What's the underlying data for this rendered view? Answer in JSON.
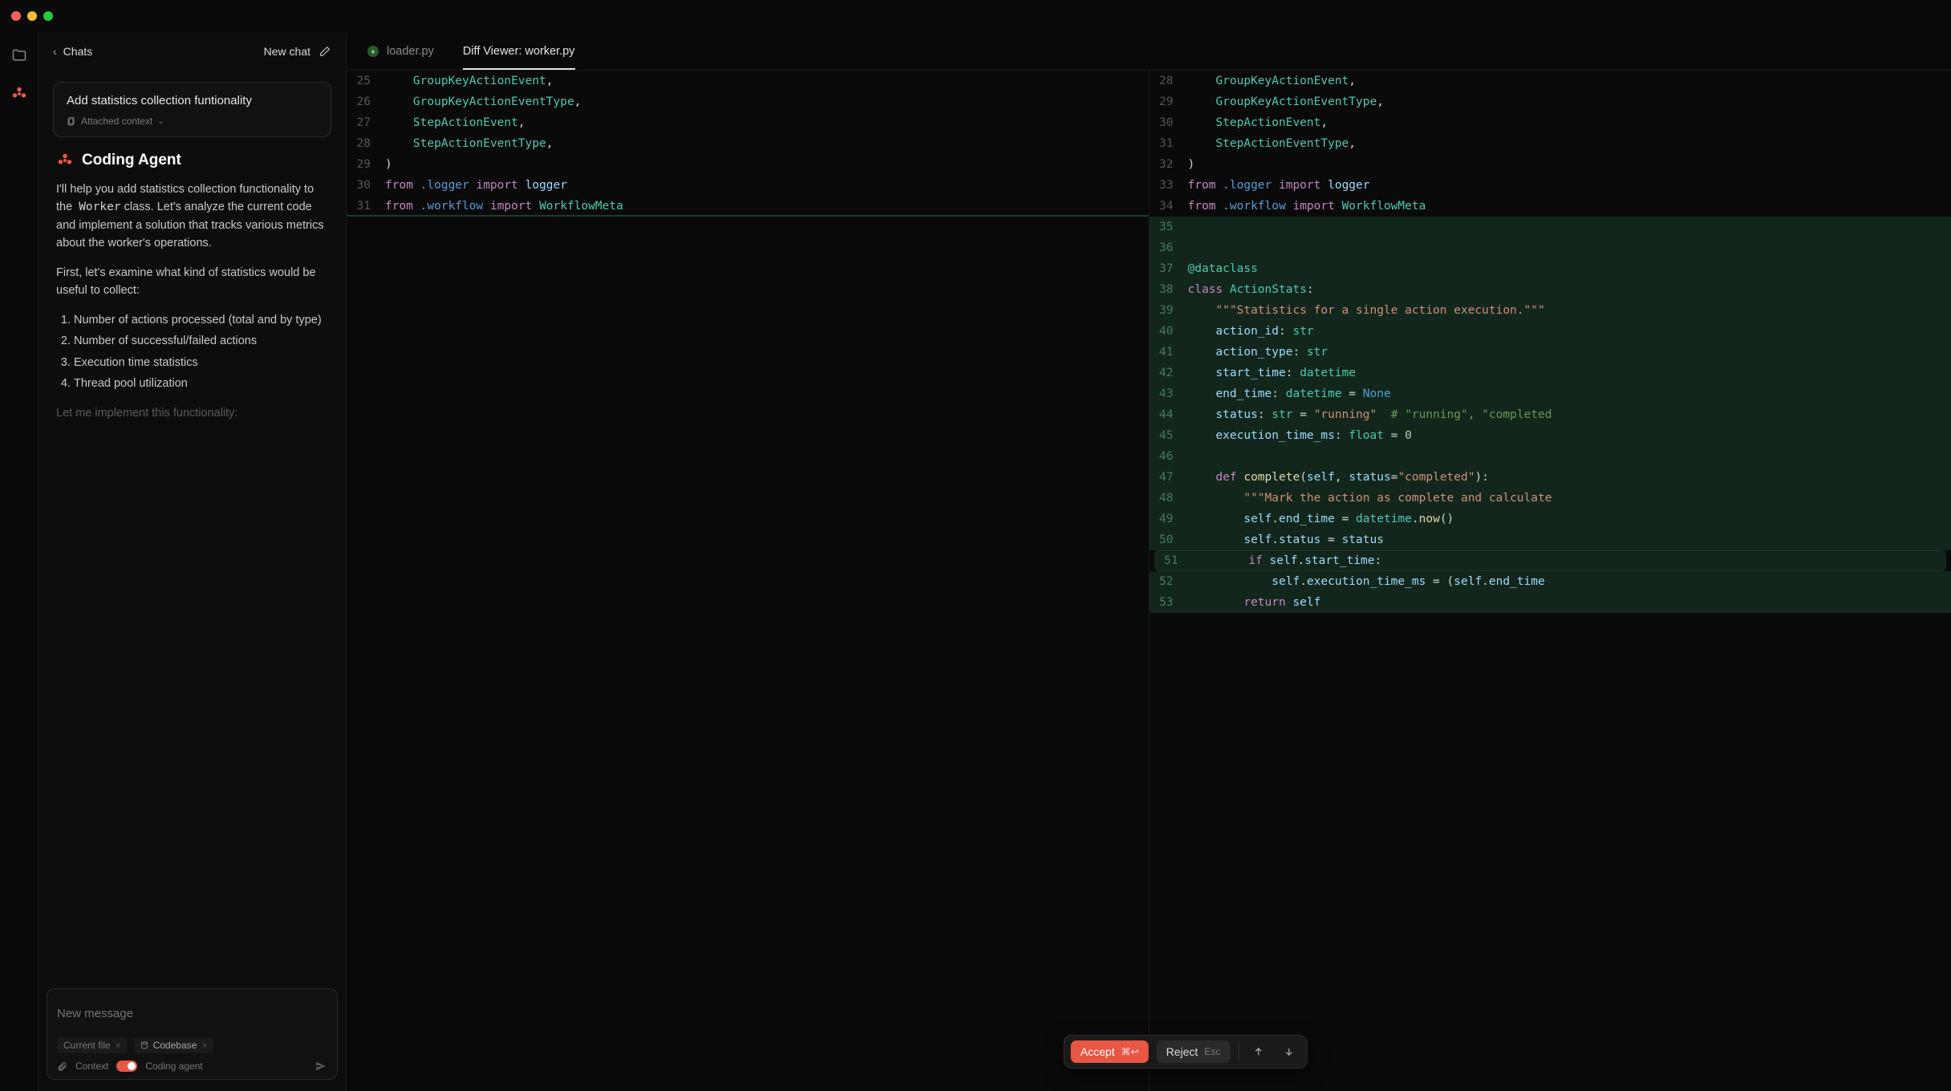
{
  "sidebar": {
    "back_label": "Chats",
    "new_chat_label": "New chat",
    "conversation": {
      "title": "Add statistics collection funtionality",
      "attached_label": "Attached context"
    },
    "agent": {
      "title": "Coding Agent",
      "intro_pre": "I'll help you add statistics collection functionality to the ",
      "intro_code": "Worker",
      "intro_post": " class. Let's analyze the current code and implement a solution that tracks various metrics about the worker's operations.",
      "para2": "First, let's examine what kind of statistics would be useful to collect:",
      "bullets": [
        "Number of actions processed (total and by type)",
        "Number of successful/failed actions",
        "Execution time statistics",
        "Thread pool utilization"
      ],
      "closing": "Let me implement this functionality:"
    },
    "composer": {
      "placeholder": "New message",
      "chip_current": "Current file",
      "chip_codebase": "Codebase",
      "context_label": "Context",
      "mode_label": "Coding agent"
    }
  },
  "tabs": [
    {
      "label": "loader.py",
      "active": false,
      "hasIcon": true
    },
    {
      "label": "Diff Viewer: worker.py",
      "active": true,
      "hasIcon": false
    }
  ],
  "diff": {
    "left": [
      {
        "n": 25,
        "tokens": [
          [
            "    ",
            ""
          ],
          [
            "GroupKeyActionEvent",
            "t-type"
          ],
          [
            ",",
            "t-pl"
          ]
        ]
      },
      {
        "n": 26,
        "tokens": [
          [
            "    ",
            ""
          ],
          [
            "GroupKeyActionEventType",
            "t-type"
          ],
          [
            ",",
            "t-pl"
          ]
        ]
      },
      {
        "n": 27,
        "tokens": [
          [
            "    ",
            ""
          ],
          [
            "StepActionEvent",
            "t-type"
          ],
          [
            ",",
            "t-pl"
          ]
        ]
      },
      {
        "n": 28,
        "tokens": [
          [
            "    ",
            ""
          ],
          [
            "StepActionEventType",
            "t-type"
          ],
          [
            ",",
            "t-pl"
          ]
        ]
      },
      {
        "n": 29,
        "tokens": [
          [
            ")",
            "t-pl"
          ]
        ]
      },
      {
        "n": 30,
        "tokens": [
          [
            "from ",
            "t-kw"
          ],
          [
            ".logger",
            "t-mod"
          ],
          [
            " import ",
            "t-kw"
          ],
          [
            "logger",
            "t-ident"
          ]
        ]
      },
      {
        "n": 31,
        "tokens": [
          [
            "from ",
            "t-kw"
          ],
          [
            ".workflow",
            "t-mod"
          ],
          [
            " import ",
            "t-kw"
          ],
          [
            "WorkflowMeta",
            "t-type"
          ]
        ],
        "edgeGreen": true
      }
    ],
    "right": [
      {
        "n": 28,
        "tokens": [
          [
            "    ",
            ""
          ],
          [
            "GroupKeyActionEvent",
            "t-type"
          ],
          [
            ",",
            "t-pl"
          ]
        ]
      },
      {
        "n": 29,
        "tokens": [
          [
            "    ",
            ""
          ],
          [
            "GroupKeyActionEventType",
            "t-type"
          ],
          [
            ",",
            "t-pl"
          ]
        ]
      },
      {
        "n": 30,
        "tokens": [
          [
            "    ",
            ""
          ],
          [
            "StepActionEvent",
            "t-type"
          ],
          [
            ",",
            "t-pl"
          ]
        ]
      },
      {
        "n": 31,
        "tokens": [
          [
            "    ",
            ""
          ],
          [
            "StepActionEventType",
            "t-type"
          ],
          [
            ",",
            "t-pl"
          ]
        ]
      },
      {
        "n": 32,
        "tokens": [
          [
            ")",
            "t-pl"
          ]
        ]
      },
      {
        "n": 33,
        "tokens": [
          [
            "from ",
            "t-kw"
          ],
          [
            ".logger",
            "t-mod"
          ],
          [
            " import ",
            "t-kw"
          ],
          [
            "logger",
            "t-ident"
          ]
        ]
      },
      {
        "n": 34,
        "tokens": [
          [
            "from ",
            "t-kw"
          ],
          [
            ".workflow",
            "t-mod"
          ],
          [
            " import ",
            "t-kw"
          ],
          [
            "WorkflowMeta",
            "t-type"
          ]
        ]
      },
      {
        "n": 35,
        "green": true,
        "tokens": []
      },
      {
        "n": 36,
        "green": true,
        "tokens": []
      },
      {
        "n": 37,
        "green": true,
        "tokens": [
          [
            "@dataclass",
            "t-dec"
          ]
        ]
      },
      {
        "n": 38,
        "green": true,
        "tokens": [
          [
            "class ",
            "t-kw"
          ],
          [
            "ActionStats",
            "t-type"
          ],
          [
            ":",
            "t-pl"
          ]
        ]
      },
      {
        "n": 39,
        "green": true,
        "tokens": [
          [
            "    ",
            ""
          ],
          [
            "\"\"\"Statistics for a single action execution.\"\"\"",
            "t-str"
          ]
        ]
      },
      {
        "n": 40,
        "green": true,
        "tokens": [
          [
            "    ",
            ""
          ],
          [
            "action_id",
            "t-ident"
          ],
          [
            ": ",
            "t-pl"
          ],
          [
            "str",
            "t-type"
          ]
        ]
      },
      {
        "n": 41,
        "green": true,
        "tokens": [
          [
            "    ",
            ""
          ],
          [
            "action_type",
            "t-ident"
          ],
          [
            ": ",
            "t-pl"
          ],
          [
            "str",
            "t-type"
          ]
        ]
      },
      {
        "n": 42,
        "green": true,
        "tokens": [
          [
            "    ",
            ""
          ],
          [
            "start_time",
            "t-ident"
          ],
          [
            ": ",
            "t-pl"
          ],
          [
            "datetime",
            "t-type"
          ]
        ]
      },
      {
        "n": 43,
        "green": true,
        "tokens": [
          [
            "    ",
            ""
          ],
          [
            "end_time",
            "t-ident"
          ],
          [
            ": ",
            "t-pl"
          ],
          [
            "datetime",
            "t-type"
          ],
          [
            " = ",
            "t-pl"
          ],
          [
            "None",
            "t-const"
          ]
        ]
      },
      {
        "n": 44,
        "green": true,
        "tokens": [
          [
            "    ",
            ""
          ],
          [
            "status",
            "t-ident"
          ],
          [
            ": ",
            "t-pl"
          ],
          [
            "str",
            "t-type"
          ],
          [
            " = ",
            "t-pl"
          ],
          [
            "\"running\"",
            "t-str"
          ],
          [
            "  ",
            "t-pl"
          ],
          [
            "# \"running\", \"completed",
            "t-cmt"
          ]
        ]
      },
      {
        "n": 45,
        "green": true,
        "tokens": [
          [
            "    ",
            ""
          ],
          [
            "execution_time_ms",
            "t-ident"
          ],
          [
            ": ",
            "t-pl"
          ],
          [
            "float",
            "t-type"
          ],
          [
            " = ",
            "t-pl"
          ],
          [
            "0",
            "t-num"
          ]
        ]
      },
      {
        "n": 46,
        "green": true,
        "tokens": []
      },
      {
        "n": 47,
        "green": true,
        "tokens": [
          [
            "    ",
            ""
          ],
          [
            "def ",
            "t-kw"
          ],
          [
            "complete",
            "t-fn"
          ],
          [
            "(",
            "t-pl"
          ],
          [
            "self",
            "t-ident"
          ],
          [
            ", ",
            "t-pl"
          ],
          [
            "status",
            "t-ident"
          ],
          [
            "=",
            "t-pl"
          ],
          [
            "\"completed\"",
            "t-str"
          ],
          [
            "):",
            "t-pl"
          ]
        ]
      },
      {
        "n": 48,
        "green": true,
        "tokens": [
          [
            "        ",
            ""
          ],
          [
            "\"\"\"Mark the action as complete and calculate",
            "t-str"
          ]
        ]
      },
      {
        "n": 49,
        "green": true,
        "tokens": [
          [
            "        ",
            ""
          ],
          [
            "self",
            "t-ident"
          ],
          [
            ".",
            "t-pl"
          ],
          [
            "end_time",
            "t-ident"
          ],
          [
            " = ",
            "t-pl"
          ],
          [
            "datetime",
            "t-type"
          ],
          [
            ".",
            "t-pl"
          ],
          [
            "now",
            "t-fn"
          ],
          [
            "()",
            "t-pl"
          ]
        ]
      },
      {
        "n": 50,
        "green": true,
        "tokens": [
          [
            "        ",
            ""
          ],
          [
            "self",
            "t-ident"
          ],
          [
            ".",
            "t-pl"
          ],
          [
            "status",
            "t-ident"
          ],
          [
            " = ",
            "t-pl"
          ],
          [
            "status",
            "t-ident"
          ]
        ]
      },
      {
        "n": 51,
        "green": true,
        "halo": true,
        "tokens": [
          [
            "        ",
            ""
          ],
          [
            "if ",
            "t-kw"
          ],
          [
            "self",
            "t-ident"
          ],
          [
            ".",
            "t-pl"
          ],
          [
            "start_time",
            "t-ident"
          ],
          [
            ":",
            "t-pl"
          ]
        ]
      },
      {
        "n": 52,
        "green": true,
        "tokens": [
          [
            "            ",
            ""
          ],
          [
            "self",
            "t-ident"
          ],
          [
            ".",
            "t-pl"
          ],
          [
            "execution_time_ms",
            "t-ident"
          ],
          [
            " = (",
            "t-pl"
          ],
          [
            "self",
            "t-ident"
          ],
          [
            ".",
            "t-pl"
          ],
          [
            "end_time",
            "t-ident"
          ]
        ]
      },
      {
        "n": 53,
        "green": true,
        "tokens": [
          [
            "        ",
            ""
          ],
          [
            "return ",
            "t-kw"
          ],
          [
            "self",
            "t-ident"
          ]
        ]
      }
    ]
  },
  "actions": {
    "accept_label": "Accept",
    "accept_kbd": "⌘↩",
    "reject_label": "Reject",
    "reject_kbd": "Esc"
  }
}
